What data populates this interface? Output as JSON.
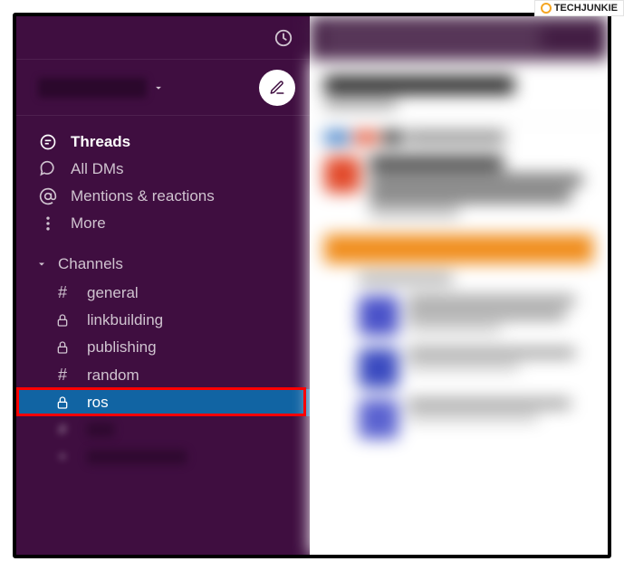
{
  "watermark": {
    "text": "TECHJUNKIE"
  },
  "nav": {
    "threads": "Threads",
    "all_dms": "All DMs",
    "mentions": "Mentions & reactions",
    "more": "More"
  },
  "sections": {
    "channels_label": "Channels"
  },
  "channels": [
    {
      "name": "general",
      "type": "public"
    },
    {
      "name": "linkbuilding",
      "type": "private"
    },
    {
      "name": "publishing",
      "type": "private"
    },
    {
      "name": "random",
      "type": "public"
    },
    {
      "name": "ros",
      "type": "private",
      "selected": true
    }
  ]
}
